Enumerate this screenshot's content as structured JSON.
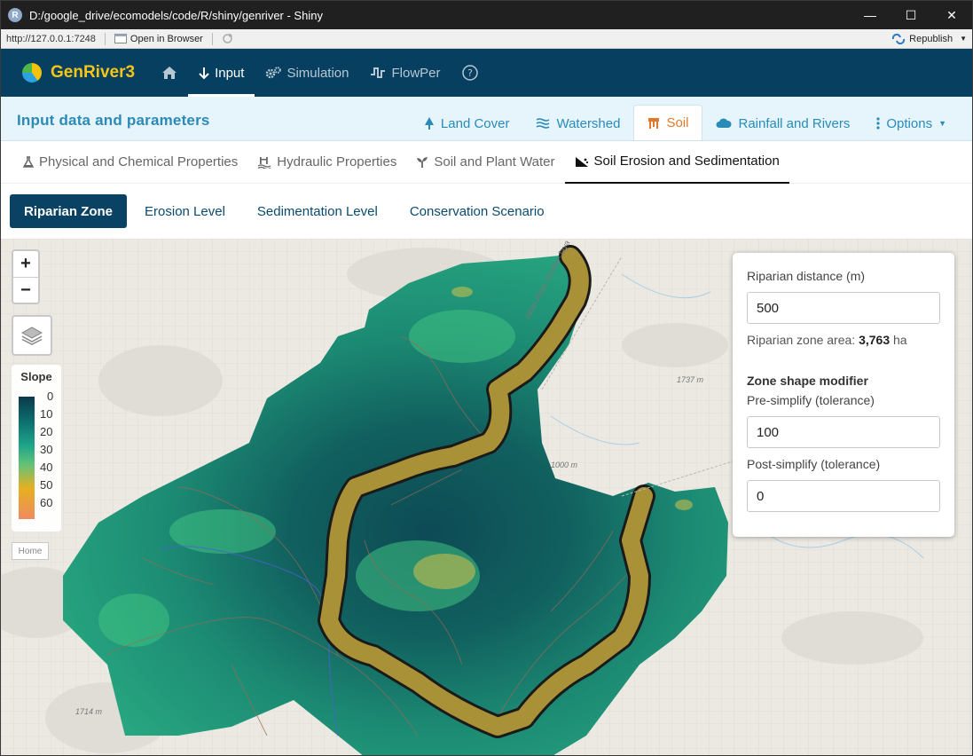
{
  "window": {
    "title": "D:/google_drive/ecomodels/code/R/shiny/genriver - Shiny",
    "r_logo": "R",
    "controls": [
      "—",
      "☐",
      "✕"
    ]
  },
  "shiny_toolbar": {
    "url": "http://127.0.0.1:7248",
    "open_in_browser": "Open in Browser",
    "republish": "Republish"
  },
  "navbar": {
    "brand_prefix": "Gen",
    "brand_suffix": "River3",
    "items": [
      {
        "label": "Input",
        "icon": "arrow-down-icon"
      },
      {
        "label": "Simulation",
        "icon": "gears-icon"
      },
      {
        "label": "FlowPer",
        "icon": "waveform-icon"
      }
    ]
  },
  "header": {
    "title": "Input data and parameters",
    "tabs": [
      {
        "label": "Land Cover",
        "icon": "tree-icon"
      },
      {
        "label": "Watershed",
        "icon": "water-icon"
      },
      {
        "label": "Soil",
        "icon": "soil-icon"
      },
      {
        "label": "Rainfall and Rivers",
        "icon": "cloud-icon"
      },
      {
        "label": "Options",
        "icon": "vertical-dots-icon"
      }
    ],
    "active_tab": "Soil"
  },
  "subtabs": [
    {
      "label": "Physical and Chemical Properties",
      "icon": "flask-icon"
    },
    {
      "label": "Hydraulic Properties",
      "icon": "water-ladder-icon"
    },
    {
      "label": "Soil and Plant Water",
      "icon": "seedling-icon"
    },
    {
      "label": "Soil Erosion and Sedimentation",
      "icon": "hill-slope-icon"
    }
  ],
  "pills": [
    "Riparian Zone",
    "Erosion Level",
    "Sedimentation Level",
    "Conservation Scenario"
  ],
  "map": {
    "zoom_in": "+",
    "zoom_out": "−",
    "legend": {
      "title": "Slope",
      "ticks": [
        "0",
        "10",
        "20",
        "30",
        "40",
        "50",
        "60"
      ]
    },
    "home_label": "Home",
    "labels": {
      "elev1": "1000 m",
      "elev2": "1714 m",
      "elev3": "1737 m",
      "road": "Jalan Raya Jember-Jaya"
    }
  },
  "panel": {
    "riparian_label": "Riparian distance (m)",
    "riparian_value": "500",
    "area_prefix": "Riparian zone area:",
    "area_value": "3,763",
    "area_unit": "ha",
    "modifier_heading": "Zone shape modifier",
    "pre_label": "Pre-simplify (tolerance)",
    "pre_value": "100",
    "post_label": "Post-simplify (tolerance)",
    "post_value": "0"
  },
  "colors": {
    "navbar": "#063f5f",
    "brand": "#f5c518",
    "header_bg": "#e6f4fb",
    "accent": "#2b8ab8",
    "active_tab": "#e2782b",
    "pill_active": "#0a4264"
  }
}
